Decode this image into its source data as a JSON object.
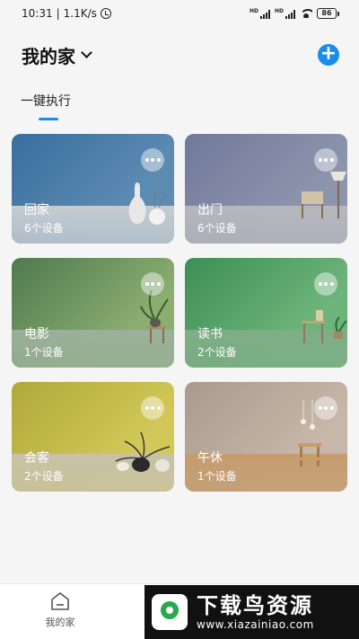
{
  "status_bar": {
    "time": "10:31",
    "speed": "1.1K/s",
    "network_labels": [
      "HD",
      "HD"
    ],
    "battery": "86"
  },
  "header": {
    "title": "我的家"
  },
  "tabs": [
    {
      "label": "一键执行",
      "active": true
    }
  ],
  "scenes": [
    {
      "name": "回家",
      "devices": "6个设备",
      "colors": {
        "top": "#3a6e9e",
        "mid": "#5d8cb3",
        "floor": "#c6ccd1"
      }
    },
    {
      "name": "出门",
      "devices": "6个设备",
      "colors": {
        "top": "#71799a",
        "mid": "#8d95ad",
        "floor": "#b7b7bd"
      }
    },
    {
      "name": "电影",
      "devices": "1个设备",
      "colors": {
        "top": "#4f7a4f",
        "mid": "#8aad70",
        "floor": "#9bb09a"
      }
    },
    {
      "name": "读书",
      "devices": "2个设备",
      "colors": {
        "top": "#3d8f55",
        "mid": "#6db47a",
        "floor": "#7fae86"
      }
    },
    {
      "name": "会客",
      "devices": "2个设备",
      "colors": {
        "top": "#b0a83a",
        "mid": "#d2c85a",
        "floor": "#c8c2a8"
      }
    },
    {
      "name": "午休",
      "devices": "1个设备",
      "colors": {
        "top": "#a89a8e",
        "mid": "#c6b7a8",
        "floor": "#c69c6e"
      }
    }
  ],
  "bottom_nav": {
    "home_label": "我的家"
  },
  "watermark": {
    "title": "下载鸟资源",
    "url": "www.xiazainiao.com"
  },
  "accent_color": "#1a8cf0"
}
